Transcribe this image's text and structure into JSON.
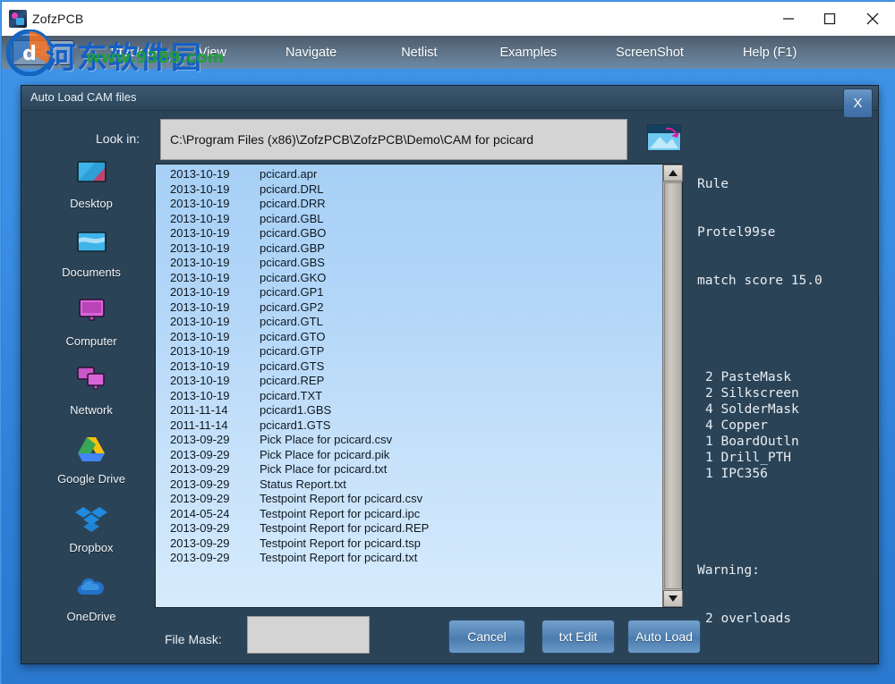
{
  "window": {
    "title": "ZofzPCB",
    "minimize_label": "minimize",
    "maximize_label": "maximize",
    "close_label": "close"
  },
  "menu": {
    "items": [
      {
        "id": "file",
        "label": "File"
      },
      {
        "id": "stackup",
        "label": "Stackup"
      },
      {
        "id": "view",
        "label": "View"
      },
      {
        "id": "navigate",
        "label": "Navigate"
      },
      {
        "id": "netlist",
        "label": "Netlist"
      },
      {
        "id": "examples",
        "label": "Examples"
      },
      {
        "id": "screenshot",
        "label": "ScreenShot"
      },
      {
        "id": "help",
        "label": "Help (F1)"
      }
    ]
  },
  "watermark": {
    "chinese": "河东软件园",
    "url": "www.9389.com"
  },
  "dialog": {
    "title": "Auto Load CAM files",
    "close_label": "X",
    "lookin_label": "Look in:",
    "lookin_value": "C:\\Program Files (x86)\\ZofzPCB\\ZofzPCB\\Demo\\CAM for pcicard",
    "browse_icon": "folder-picture-icon",
    "filemask_label": "File Mask:",
    "filemask_value": "",
    "buttons": {
      "cancel": "Cancel",
      "txt_edit": "txt Edit",
      "auto_load": "Auto Load"
    }
  },
  "places": [
    {
      "id": "desktop",
      "label": "Desktop",
      "icon": "desktop-icon"
    },
    {
      "id": "documents",
      "label": "Documents",
      "icon": "documents-folder-icon"
    },
    {
      "id": "computer",
      "label": "Computer",
      "icon": "computer-monitor-icon"
    },
    {
      "id": "network",
      "label": "Network",
      "icon": "network-icon"
    },
    {
      "id": "google-drive",
      "label": "Google Drive",
      "icon": "google-drive-icon"
    },
    {
      "id": "dropbox",
      "label": "Dropbox",
      "icon": "dropbox-icon"
    },
    {
      "id": "onedrive",
      "label": "OneDrive",
      "icon": "onedrive-cloud-icon"
    }
  ],
  "files": [
    {
      "date": "2013-10-19",
      "name": "pcicard.apr"
    },
    {
      "date": "2013-10-19",
      "name": "pcicard.DRL"
    },
    {
      "date": "2013-10-19",
      "name": "pcicard.DRR"
    },
    {
      "date": "2013-10-19",
      "name": "pcicard.GBL"
    },
    {
      "date": "2013-10-19",
      "name": "pcicard.GBO"
    },
    {
      "date": "2013-10-19",
      "name": "pcicard.GBP"
    },
    {
      "date": "2013-10-19",
      "name": "pcicard.GBS"
    },
    {
      "date": "2013-10-19",
      "name": "pcicard.GKO"
    },
    {
      "date": "2013-10-19",
      "name": "pcicard.GP1"
    },
    {
      "date": "2013-10-19",
      "name": "pcicard.GP2"
    },
    {
      "date": "2013-10-19",
      "name": "pcicard.GTL"
    },
    {
      "date": "2013-10-19",
      "name": "pcicard.GTO"
    },
    {
      "date": "2013-10-19",
      "name": "pcicard.GTP"
    },
    {
      "date": "2013-10-19",
      "name": "pcicard.GTS"
    },
    {
      "date": "2013-10-19",
      "name": "pcicard.REP"
    },
    {
      "date": "2013-10-19",
      "name": "pcicard.TXT"
    },
    {
      "date": "2011-11-14",
      "name": "pcicard1.GBS"
    },
    {
      "date": "2011-11-14",
      "name": "pcicard1.GTS"
    },
    {
      "date": "2013-09-29",
      "name": "Pick Place for pcicard.csv"
    },
    {
      "date": "2013-09-29",
      "name": "Pick Place for pcicard.pik"
    },
    {
      "date": "2013-09-29",
      "name": "Pick Place for pcicard.txt"
    },
    {
      "date": "2013-09-29",
      "name": "Status Report.txt"
    },
    {
      "date": "2013-09-29",
      "name": "Testpoint Report for pcicard.csv"
    },
    {
      "date": "2014-05-24",
      "name": "Testpoint Report for pcicard.ipc"
    },
    {
      "date": "2013-09-29",
      "name": "Testpoint Report for pcicard.REP"
    },
    {
      "date": "2013-09-29",
      "name": "Testpoint Report for pcicard.tsp"
    },
    {
      "date": "2013-09-29",
      "name": "Testpoint Report for pcicard.txt"
    }
  ],
  "rule": {
    "heading": "Rule",
    "name": "Protel99se",
    "match_score": "match score 15.0",
    "layers": [
      {
        "count": "2",
        "label": "PasteMask"
      },
      {
        "count": "2",
        "label": "Silkscreen"
      },
      {
        "count": "4",
        "label": "SolderMask"
      },
      {
        "count": "4",
        "label": "Copper"
      },
      {
        "count": "1",
        "label": "BoardOutln"
      },
      {
        "count": "1",
        "label": "Drill_PTH"
      },
      {
        "count": "1",
        "label": "IPC356"
      }
    ],
    "warning_heading": "Warning:",
    "warning_text": "2 overloads"
  },
  "scrollbar": {
    "up_arrow": "scroll-up-arrow",
    "down_arrow": "scroll-down-arrow"
  },
  "colors": {
    "dialog_bg": "#2b4356",
    "list_bg": "#b2d6f8",
    "accent_blue": "#2f85e0",
    "button_blue": "#5484b5",
    "watermark_blue": "#1560c4",
    "watermark_green": "#1f9e3a"
  }
}
